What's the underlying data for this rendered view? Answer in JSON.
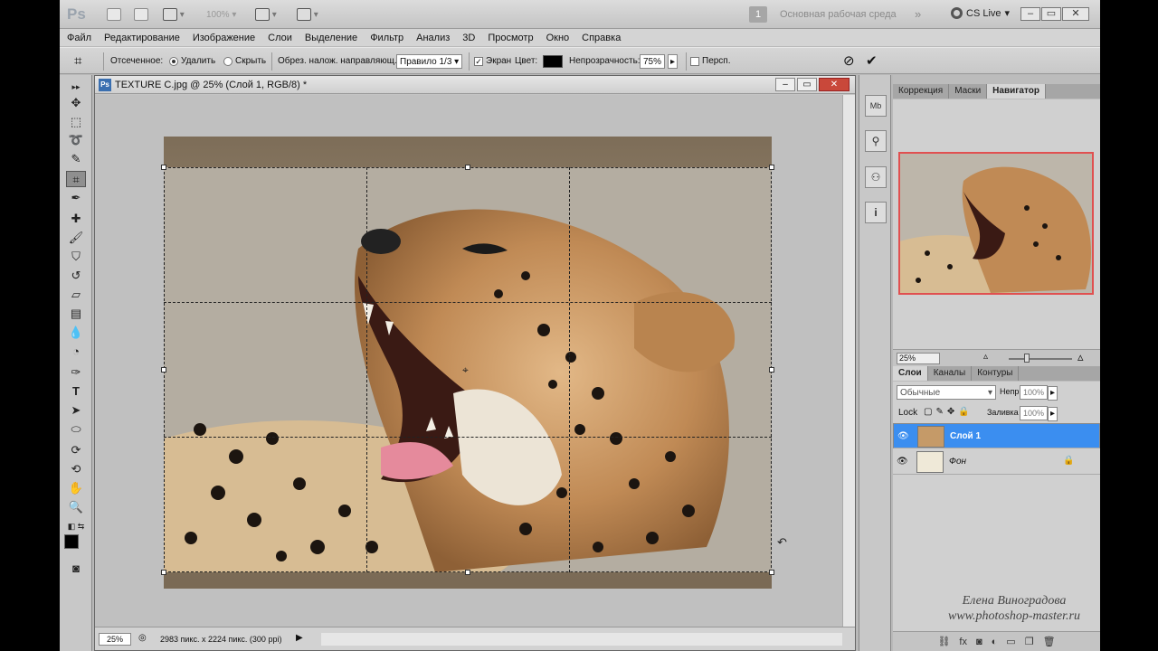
{
  "appbar": {
    "logo": "Ps",
    "zoom_value": "100%",
    "workspace_number": "1",
    "workspace_label": "Основная рабочая среда",
    "cslive_label": "CS Live",
    "icons": [
      "bridge-icon",
      "minibridge-icon",
      "guides-icon",
      "arrange-icon",
      "screen-mode-icon"
    ]
  },
  "menu": [
    "Файл",
    "Редактирование",
    "Изображение",
    "Слои",
    "Выделение",
    "Фильтр",
    "Анализ",
    "3D",
    "Просмотр",
    "Окно",
    "Справка"
  ],
  "options": {
    "cropped_label": "Отсеченное:",
    "delete_label": "Удалить",
    "hide_label": "Скрыть",
    "overlay_label": "Обрез. налож. направляющ.:",
    "overlay_value": "Правило 1/3",
    "shield_label": "Экран",
    "color_label": "Цвет:",
    "opacity_label": "Непрозрачность:",
    "opacity_value": "75%",
    "perspective_label": "Персп.",
    "shield_color": "#000000"
  },
  "document": {
    "title": "TEXTURE C.jpg @ 25% (Слой 1, RGB/8) *",
    "zoom": "25%",
    "info": "2983 пикс. x 2224 пикс. (300 ppi)"
  },
  "panels": {
    "top_tabs": [
      "Коррекция",
      "Маски",
      "Навигатор"
    ],
    "active_top_tab": "Навигатор",
    "navigator_zoom": "25%",
    "layer_tabs": [
      "Слои",
      "Каналы",
      "Контуры"
    ],
    "blend_mode": "Обычные",
    "opacity_label": "Непр",
    "opacity_value": "100%",
    "lock_label": "Lock",
    "fill_label": "Заливка",
    "fill_value": "100%",
    "layers": [
      {
        "name": "Слой 1",
        "selected": true,
        "locked": false
      },
      {
        "name": "Фон",
        "selected": false,
        "locked": true
      }
    ]
  },
  "watermark": {
    "line1": "Елена Виноградова",
    "line2": "www.photoshop-master.ru"
  },
  "colors": {
    "selection_blue": "#3b8ef0",
    "close_red": "#c9483a",
    "navigator_frame": "#e05050"
  }
}
